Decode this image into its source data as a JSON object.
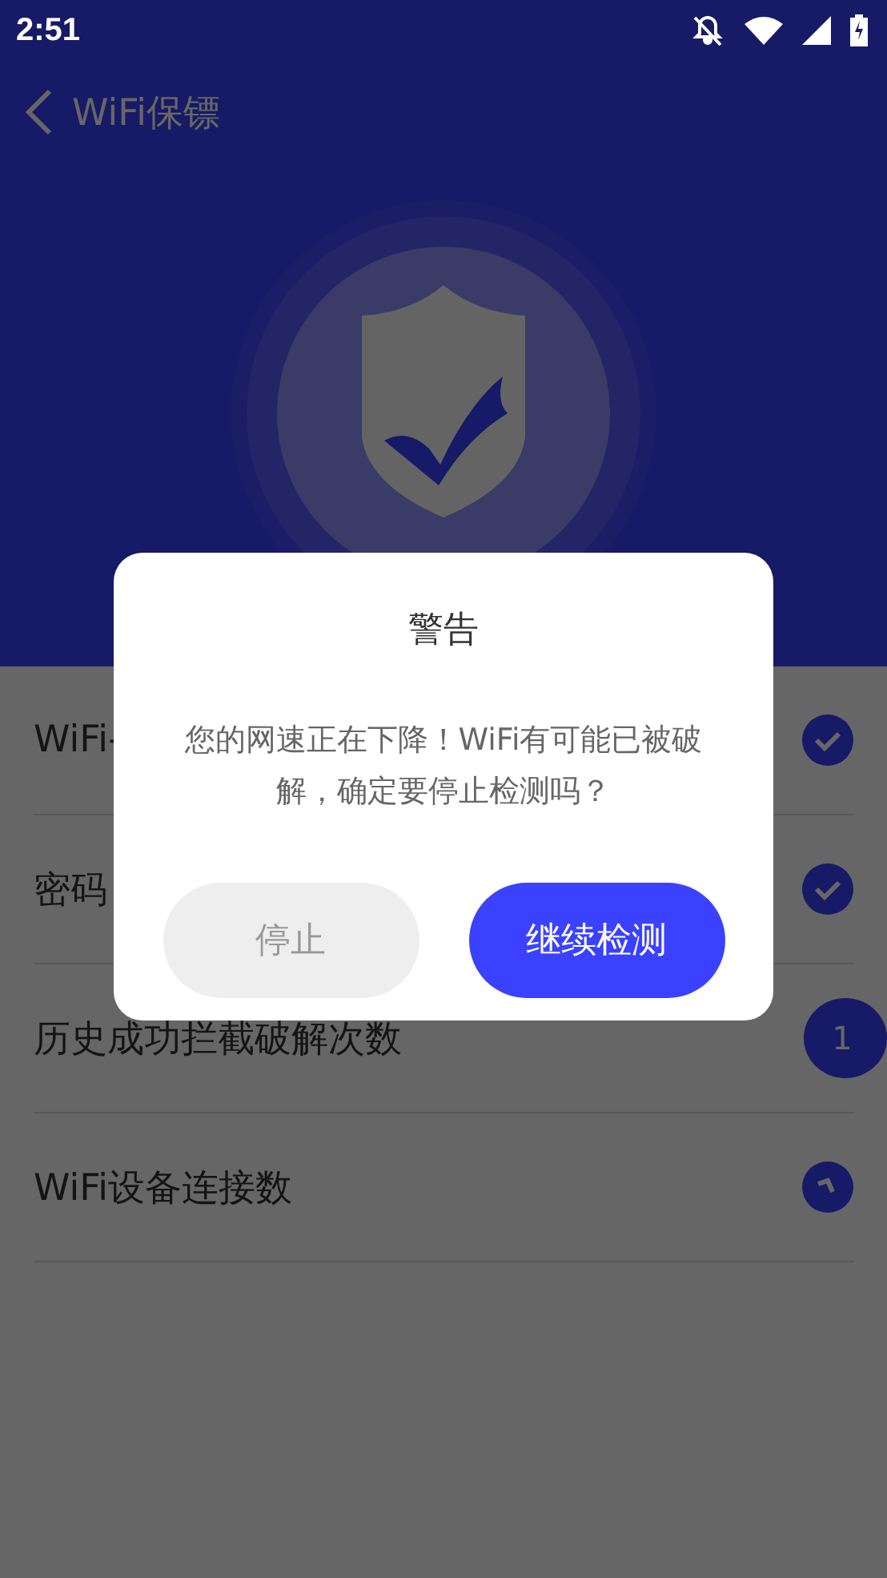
{
  "status_bar": {
    "time": "2:51"
  },
  "header": {
    "title": "WiFi保镖"
  },
  "rows": [
    {
      "label": "WiFi-",
      "kind": "check"
    },
    {
      "label": "密码",
      "kind": "check"
    },
    {
      "label": "历史成功拦截破解次数",
      "kind": "count",
      "value": "1"
    },
    {
      "label": "WiFi设备连接数",
      "kind": "progress"
    }
  ],
  "dialog": {
    "title": "警告",
    "message": "您的网速正在下降！WiFi有可能已被破解，确定要停止检测吗？",
    "buttons": [
      {
        "label": "停止",
        "kind": "secondary"
      },
      {
        "label": "继续检测",
        "kind": "primary"
      }
    ]
  }
}
